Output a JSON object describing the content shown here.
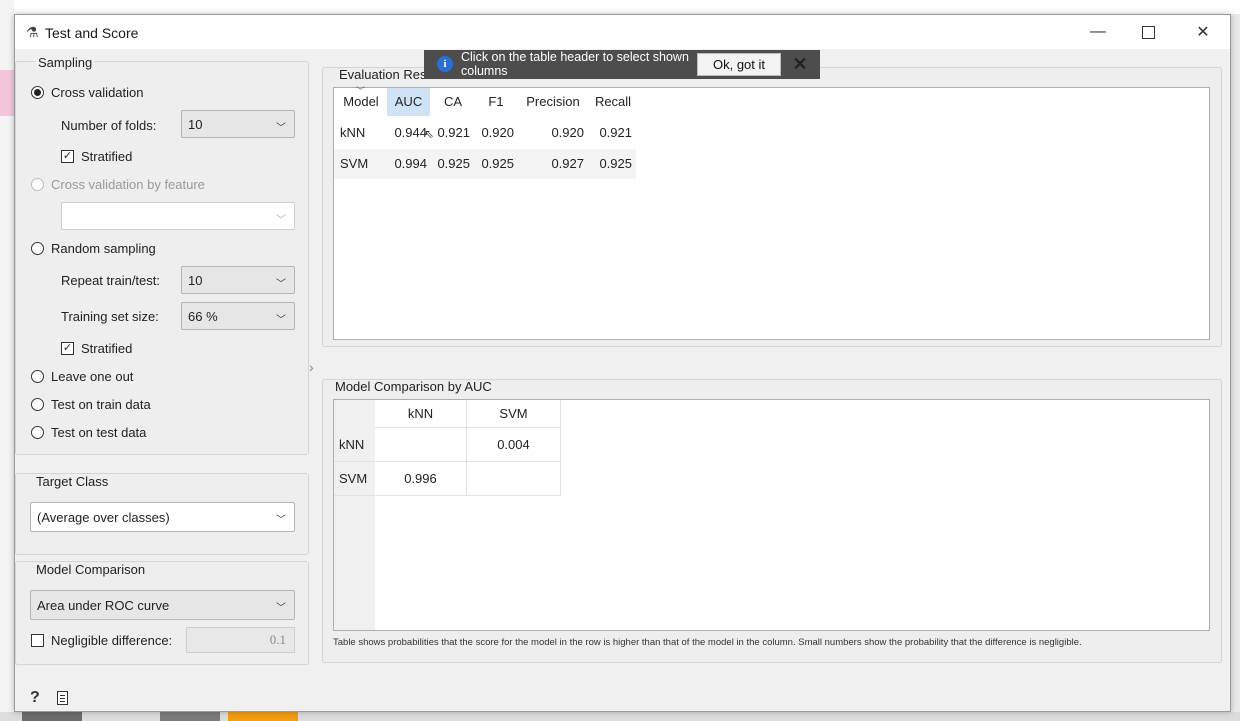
{
  "window": {
    "title": "Test and Score"
  },
  "sampling": {
    "title": "Sampling",
    "cross_validation": "Cross validation",
    "number_of_folds_label": "Number of folds:",
    "number_of_folds_value": "10",
    "stratified_1": "Stratified",
    "cv_by_feature": "Cross validation by feature",
    "random_sampling": "Random sampling",
    "repeat_label": "Repeat train/test:",
    "repeat_value": "10",
    "training_size_label": "Training set size:",
    "training_size_value": "66 %",
    "stratified_2": "Stratified",
    "leave_one_out": "Leave one out",
    "test_on_train": "Test on train data",
    "test_on_test": "Test on test data"
  },
  "target_class": {
    "title": "Target Class",
    "value": "(Average over classes)"
  },
  "model_comparison": {
    "title": "Model Comparison",
    "value": "Area under ROC curve",
    "negligible_label": "Negligible difference:",
    "negligible_value": "0.1"
  },
  "evaluation": {
    "title": "Evaluation Resu",
    "headers": [
      "Model",
      "AUC",
      "CA",
      "F1",
      "Precision",
      "Recall"
    ],
    "rows": [
      [
        "kNN",
        "0.944",
        "0.921",
        "0.920",
        "0.920",
        "0.921"
      ],
      [
        "SVM",
        "0.994",
        "0.925",
        "0.925",
        "0.927",
        "0.925"
      ]
    ]
  },
  "comparison": {
    "title": "Model Comparison by AUC",
    "col_headers": [
      "kNN",
      "SVM"
    ],
    "row_headers": [
      "kNN",
      "SVM"
    ],
    "cells": [
      [
        "",
        "0.004"
      ],
      [
        "0.996",
        ""
      ]
    ],
    "note": "Table shows probabilities that the score for the model in the row is higher than that of the model in the column. Small numbers show the probability that the difference is negligible."
  },
  "tooltip": {
    "text": "Click on the table header to select shown columns",
    "ok_label": "Ok, got it"
  }
}
